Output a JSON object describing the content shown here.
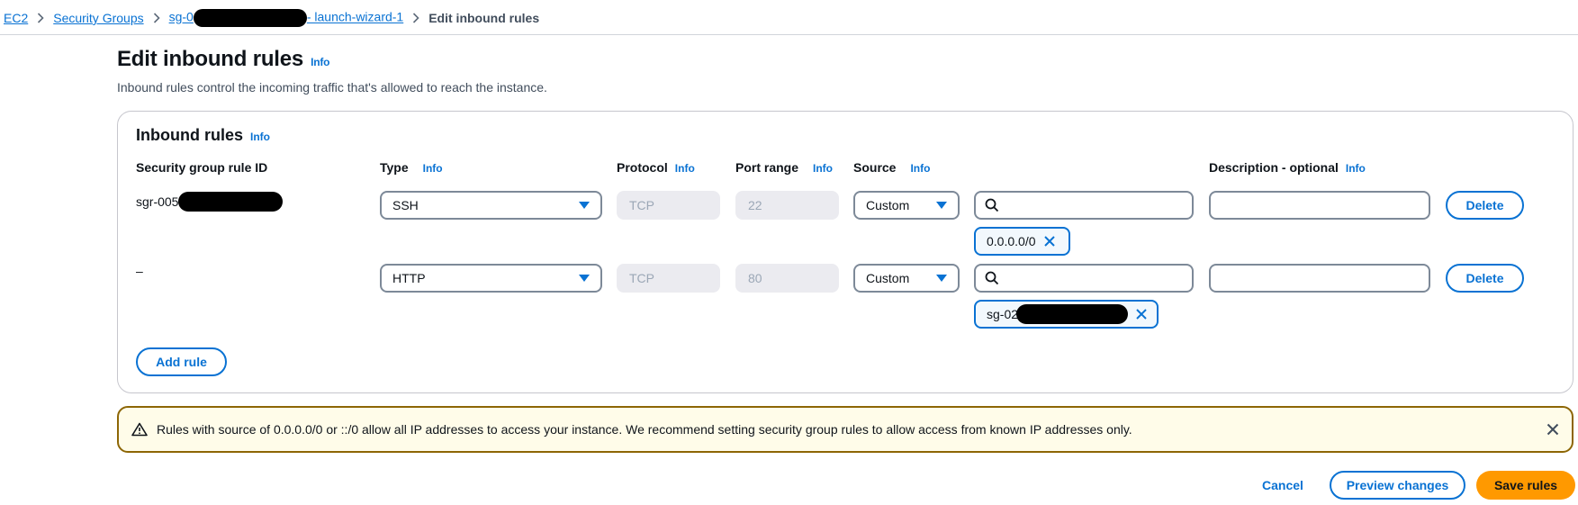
{
  "breadcrumb": {
    "items": [
      "EC2",
      "Security Groups"
    ],
    "sg_prefix": "sg-0",
    "sg_suffix": "- launch-wizard-1",
    "current": "Edit inbound rules"
  },
  "page": {
    "title": "Edit inbound rules",
    "info_label": "Info",
    "description": "Inbound rules control the incoming traffic that's allowed to reach the instance."
  },
  "panel": {
    "title": "Inbound rules",
    "info_label": "Info",
    "columns": {
      "rule_id": "Security group rule ID",
      "type": "Type",
      "protocol": "Protocol",
      "port_range": "Port range",
      "source": "Source",
      "description": "Description - optional"
    },
    "rules": [
      {
        "rule_id": "sgr-005",
        "type": "SSH",
        "protocol": "TCP",
        "port_range": "22",
        "source_type": "Custom",
        "search_value": "",
        "source_token": "0.0.0.0/0",
        "description": "",
        "delete_label": "Delete"
      },
      {
        "rule_id": "–",
        "type": "HTTP",
        "protocol": "TCP",
        "port_range": "80",
        "source_type": "Custom",
        "search_value": "",
        "source_token": "sg-02",
        "description": "",
        "delete_label": "Delete"
      }
    ],
    "add_rule_label": "Add rule"
  },
  "alert": {
    "text": "Rules with source of 0.0.0.0/0 or ::/0 allow all IP addresses to access your instance. We recommend setting security group rules to allow access from known IP addresses only."
  },
  "footer": {
    "cancel_label": "Cancel",
    "preview_label": "Preview changes",
    "save_label": "Save rules"
  },
  "colors": {
    "accent": "#0972d3",
    "primary_button": "#ff9900",
    "warning_border": "#8d6605",
    "warning_background": "#fffce9"
  }
}
